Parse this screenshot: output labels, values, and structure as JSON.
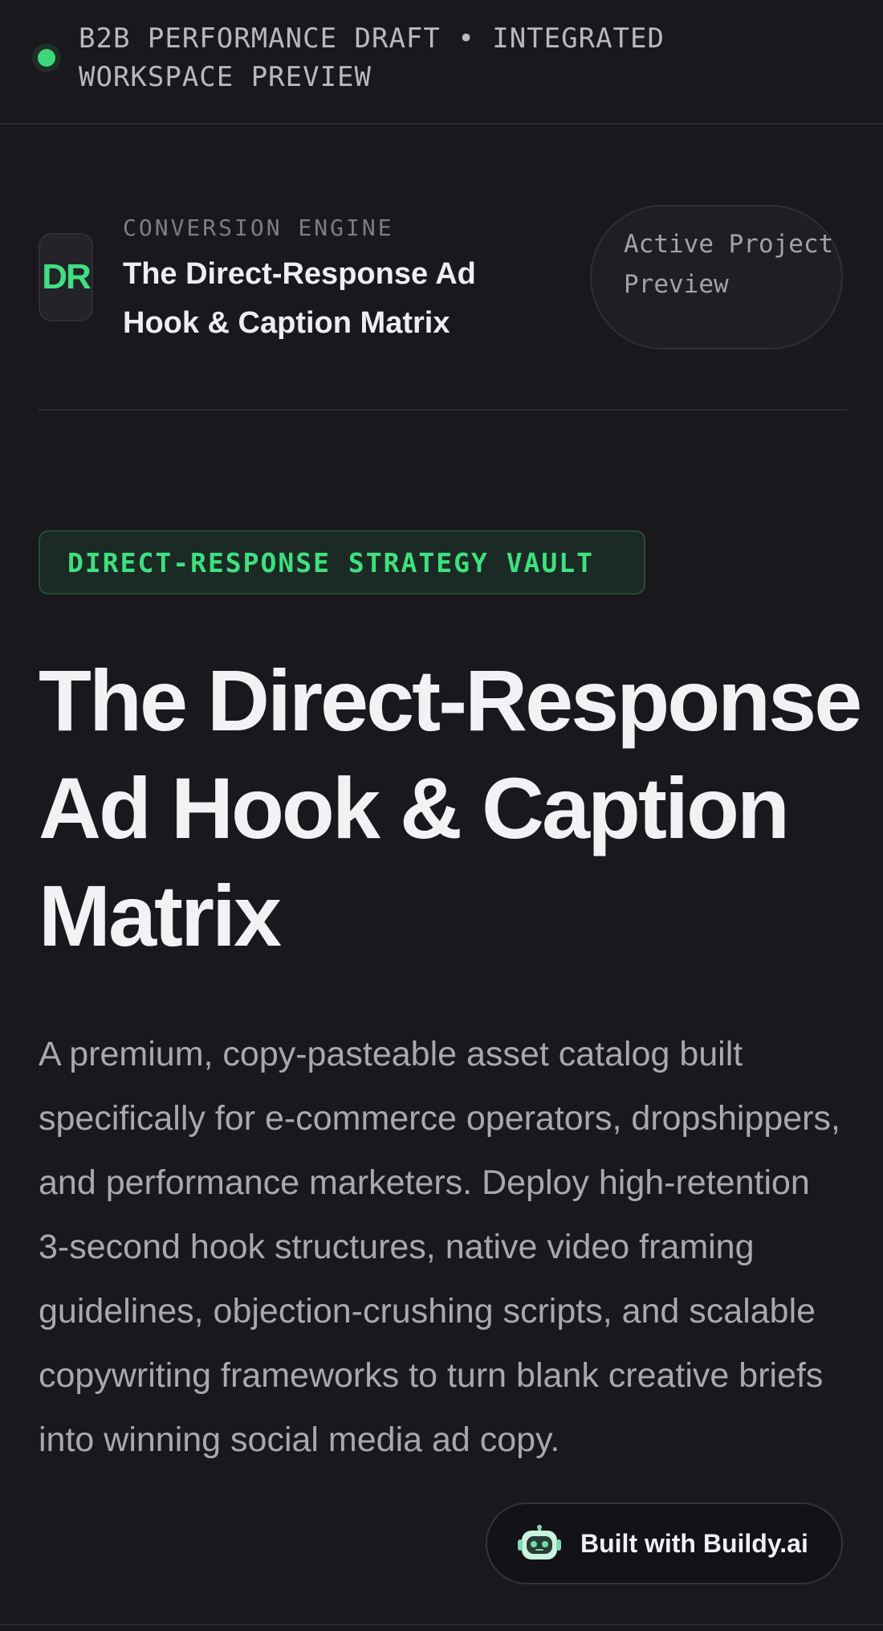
{
  "topbar": {
    "status_label": "B2B PERFORMANCE DRAFT • INTEGRATED WORKSPACE PREVIEW",
    "status_color": "#3ed67a"
  },
  "header": {
    "logo_text": "DR",
    "eyebrow": "CONVERSION ENGINE",
    "title": "The Direct-Response Ad Hook & Caption Matrix",
    "preview_label": "Active Project Preview"
  },
  "hero": {
    "badge": "DIRECT-RESPONSE STRATEGY VAULT",
    "title": "The Direct-Response Ad Hook & Caption Matrix",
    "description": "A premium, copy-pasteable asset catalog built specifically for e-commerce operators, dropshippers, and performance marketers. Deploy high-retention 3-second hook structures, native video framing guidelines, objection-crushing scripts, and scalable copywriting frameworks to turn blank creative briefs into winning social media ad copy."
  },
  "footer_badge": {
    "icon": "robot-icon",
    "label": "Built with Buildy.ai"
  },
  "colors": {
    "background": "#19181c",
    "accent": "#3ee07f",
    "text_primary": "#f2f1f4",
    "text_secondary": "#a9a8ae"
  }
}
